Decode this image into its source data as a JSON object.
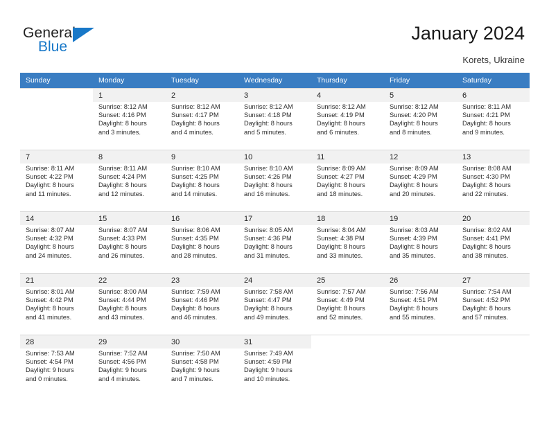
{
  "brand": {
    "word_one": "General",
    "word_two": "Blue",
    "accent_color": "#1878c8"
  },
  "header": {
    "title": "January 2024",
    "subtitle": "Korets, Ukraine"
  },
  "calendar": {
    "header_bg": "#3a7dc2",
    "weekday_headers": [
      "Sunday",
      "Monday",
      "Tuesday",
      "Wednesday",
      "Thursday",
      "Friday",
      "Saturday"
    ],
    "weeks": [
      [
        {
          "day": "",
          "sunrise": "",
          "sunset": "",
          "daylight_1": "",
          "daylight_2": ""
        },
        {
          "day": "1",
          "sunrise": "Sunrise: 8:12 AM",
          "sunset": "Sunset: 4:16 PM",
          "daylight_1": "Daylight: 8 hours",
          "daylight_2": "and 3 minutes."
        },
        {
          "day": "2",
          "sunrise": "Sunrise: 8:12 AM",
          "sunset": "Sunset: 4:17 PM",
          "daylight_1": "Daylight: 8 hours",
          "daylight_2": "and 4 minutes."
        },
        {
          "day": "3",
          "sunrise": "Sunrise: 8:12 AM",
          "sunset": "Sunset: 4:18 PM",
          "daylight_1": "Daylight: 8 hours",
          "daylight_2": "and 5 minutes."
        },
        {
          "day": "4",
          "sunrise": "Sunrise: 8:12 AM",
          "sunset": "Sunset: 4:19 PM",
          "daylight_1": "Daylight: 8 hours",
          "daylight_2": "and 6 minutes."
        },
        {
          "day": "5",
          "sunrise": "Sunrise: 8:12 AM",
          "sunset": "Sunset: 4:20 PM",
          "daylight_1": "Daylight: 8 hours",
          "daylight_2": "and 8 minutes."
        },
        {
          "day": "6",
          "sunrise": "Sunrise: 8:11 AM",
          "sunset": "Sunset: 4:21 PM",
          "daylight_1": "Daylight: 8 hours",
          "daylight_2": "and 9 minutes."
        }
      ],
      [
        {
          "day": "7",
          "sunrise": "Sunrise: 8:11 AM",
          "sunset": "Sunset: 4:22 PM",
          "daylight_1": "Daylight: 8 hours",
          "daylight_2": "and 11 minutes."
        },
        {
          "day": "8",
          "sunrise": "Sunrise: 8:11 AM",
          "sunset": "Sunset: 4:24 PM",
          "daylight_1": "Daylight: 8 hours",
          "daylight_2": "and 12 minutes."
        },
        {
          "day": "9",
          "sunrise": "Sunrise: 8:10 AM",
          "sunset": "Sunset: 4:25 PM",
          "daylight_1": "Daylight: 8 hours",
          "daylight_2": "and 14 minutes."
        },
        {
          "day": "10",
          "sunrise": "Sunrise: 8:10 AM",
          "sunset": "Sunset: 4:26 PM",
          "daylight_1": "Daylight: 8 hours",
          "daylight_2": "and 16 minutes."
        },
        {
          "day": "11",
          "sunrise": "Sunrise: 8:09 AM",
          "sunset": "Sunset: 4:27 PM",
          "daylight_1": "Daylight: 8 hours",
          "daylight_2": "and 18 minutes."
        },
        {
          "day": "12",
          "sunrise": "Sunrise: 8:09 AM",
          "sunset": "Sunset: 4:29 PM",
          "daylight_1": "Daylight: 8 hours",
          "daylight_2": "and 20 minutes."
        },
        {
          "day": "13",
          "sunrise": "Sunrise: 8:08 AM",
          "sunset": "Sunset: 4:30 PM",
          "daylight_1": "Daylight: 8 hours",
          "daylight_2": "and 22 minutes."
        }
      ],
      [
        {
          "day": "14",
          "sunrise": "Sunrise: 8:07 AM",
          "sunset": "Sunset: 4:32 PM",
          "daylight_1": "Daylight: 8 hours",
          "daylight_2": "and 24 minutes."
        },
        {
          "day": "15",
          "sunrise": "Sunrise: 8:07 AM",
          "sunset": "Sunset: 4:33 PM",
          "daylight_1": "Daylight: 8 hours",
          "daylight_2": "and 26 minutes."
        },
        {
          "day": "16",
          "sunrise": "Sunrise: 8:06 AM",
          "sunset": "Sunset: 4:35 PM",
          "daylight_1": "Daylight: 8 hours",
          "daylight_2": "and 28 minutes."
        },
        {
          "day": "17",
          "sunrise": "Sunrise: 8:05 AM",
          "sunset": "Sunset: 4:36 PM",
          "daylight_1": "Daylight: 8 hours",
          "daylight_2": "and 31 minutes."
        },
        {
          "day": "18",
          "sunrise": "Sunrise: 8:04 AM",
          "sunset": "Sunset: 4:38 PM",
          "daylight_1": "Daylight: 8 hours",
          "daylight_2": "and 33 minutes."
        },
        {
          "day": "19",
          "sunrise": "Sunrise: 8:03 AM",
          "sunset": "Sunset: 4:39 PM",
          "daylight_1": "Daylight: 8 hours",
          "daylight_2": "and 35 minutes."
        },
        {
          "day": "20",
          "sunrise": "Sunrise: 8:02 AM",
          "sunset": "Sunset: 4:41 PM",
          "daylight_1": "Daylight: 8 hours",
          "daylight_2": "and 38 minutes."
        }
      ],
      [
        {
          "day": "21",
          "sunrise": "Sunrise: 8:01 AM",
          "sunset": "Sunset: 4:42 PM",
          "daylight_1": "Daylight: 8 hours",
          "daylight_2": "and 41 minutes."
        },
        {
          "day": "22",
          "sunrise": "Sunrise: 8:00 AM",
          "sunset": "Sunset: 4:44 PM",
          "daylight_1": "Daylight: 8 hours",
          "daylight_2": "and 43 minutes."
        },
        {
          "day": "23",
          "sunrise": "Sunrise: 7:59 AM",
          "sunset": "Sunset: 4:46 PM",
          "daylight_1": "Daylight: 8 hours",
          "daylight_2": "and 46 minutes."
        },
        {
          "day": "24",
          "sunrise": "Sunrise: 7:58 AM",
          "sunset": "Sunset: 4:47 PM",
          "daylight_1": "Daylight: 8 hours",
          "daylight_2": "and 49 minutes."
        },
        {
          "day": "25",
          "sunrise": "Sunrise: 7:57 AM",
          "sunset": "Sunset: 4:49 PM",
          "daylight_1": "Daylight: 8 hours",
          "daylight_2": "and 52 minutes."
        },
        {
          "day": "26",
          "sunrise": "Sunrise: 7:56 AM",
          "sunset": "Sunset: 4:51 PM",
          "daylight_1": "Daylight: 8 hours",
          "daylight_2": "and 55 minutes."
        },
        {
          "day": "27",
          "sunrise": "Sunrise: 7:54 AM",
          "sunset": "Sunset: 4:52 PM",
          "daylight_1": "Daylight: 8 hours",
          "daylight_2": "and 57 minutes."
        }
      ],
      [
        {
          "day": "28",
          "sunrise": "Sunrise: 7:53 AM",
          "sunset": "Sunset: 4:54 PM",
          "daylight_1": "Daylight: 9 hours",
          "daylight_2": "and 0 minutes."
        },
        {
          "day": "29",
          "sunrise": "Sunrise: 7:52 AM",
          "sunset": "Sunset: 4:56 PM",
          "daylight_1": "Daylight: 9 hours",
          "daylight_2": "and 4 minutes."
        },
        {
          "day": "30",
          "sunrise": "Sunrise: 7:50 AM",
          "sunset": "Sunset: 4:58 PM",
          "daylight_1": "Daylight: 9 hours",
          "daylight_2": "and 7 minutes."
        },
        {
          "day": "31",
          "sunrise": "Sunrise: 7:49 AM",
          "sunset": "Sunset: 4:59 PM",
          "daylight_1": "Daylight: 9 hours",
          "daylight_2": "and 10 minutes."
        },
        {
          "day": "",
          "sunrise": "",
          "sunset": "",
          "daylight_1": "",
          "daylight_2": ""
        },
        {
          "day": "",
          "sunrise": "",
          "sunset": "",
          "daylight_1": "",
          "daylight_2": ""
        },
        {
          "day": "",
          "sunrise": "",
          "sunset": "",
          "daylight_1": "",
          "daylight_2": ""
        }
      ]
    ]
  }
}
